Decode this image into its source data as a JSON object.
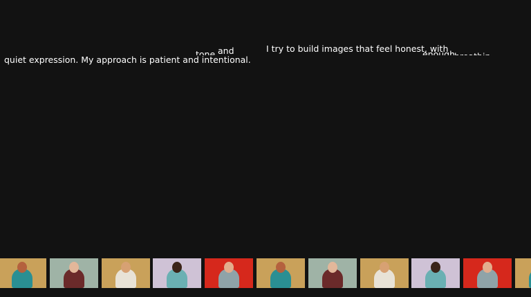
{
  "text": {
    "tone": "tone",
    "and": "and",
    "try_line": "I try to build images that feel honest, with",
    "enough": "enough",
    "fragment_end": "breathing",
    "quiet_line": "quiet expression. My approach is patient and intentional."
  },
  "strip": {
    "thumbs": [
      {
        "alt": "teal-fringe-portrait",
        "bg": "#c9a15a",
        "body": "#2a8f93",
        "skin": "#b4613e"
      },
      {
        "alt": "dark-jacket-portrait",
        "bg": "#9fb3a6",
        "body": "#6b2a2a",
        "skin": "#e2b79a"
      },
      {
        "alt": "white-tee-portrait",
        "bg": "#c9a15a",
        "body": "#e8e2d6",
        "skin": "#d7a173"
      },
      {
        "alt": "flowing-coat-portrait",
        "bg": "#cfc2d6",
        "body": "#6ab0b3",
        "skin": "#3b2418"
      },
      {
        "alt": "red-backdrop-portrait",
        "bg": "#d6281c",
        "body": "#8fa3a8",
        "skin": "#e3ad8d"
      },
      {
        "alt": "teal-fringe-portrait",
        "bg": "#c9a15a",
        "body": "#2a8f93",
        "skin": "#b4613e"
      },
      {
        "alt": "dark-jacket-portrait",
        "bg": "#9fb3a6",
        "body": "#6b2a2a",
        "skin": "#e2b79a"
      },
      {
        "alt": "white-tee-portrait",
        "bg": "#c9a15a",
        "body": "#e8e2d6",
        "skin": "#d7a173"
      },
      {
        "alt": "flowing-coat-portrait",
        "bg": "#cfc2d6",
        "body": "#6ab0b3",
        "skin": "#3b2418"
      },
      {
        "alt": "red-backdrop-portrait",
        "bg": "#d6281c",
        "body": "#8fa3a8",
        "skin": "#e3ad8d"
      },
      {
        "alt": "teal-fringe-portrait",
        "bg": "#c9a15a",
        "body": "#2a8f93",
        "skin": "#b4613e"
      }
    ]
  }
}
